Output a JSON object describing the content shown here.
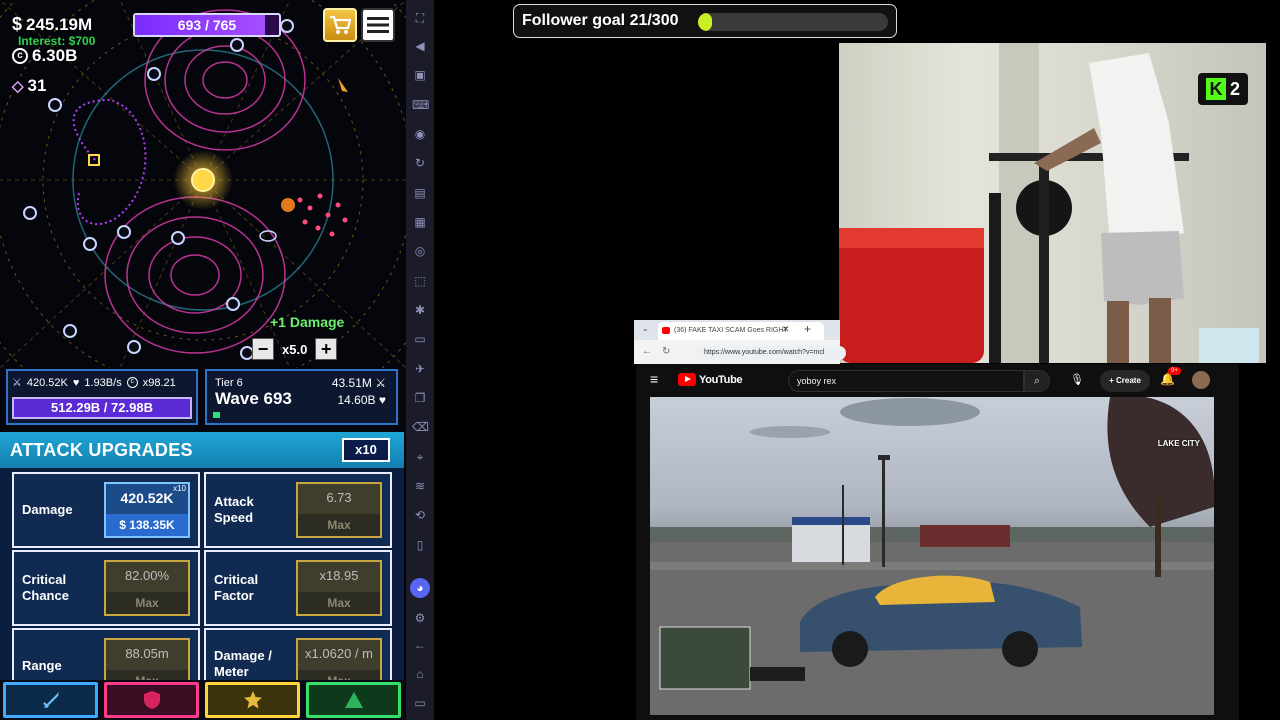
{
  "game": {
    "cash": "245.19M",
    "cash_symbol": "$",
    "interest": "Interest: $700",
    "coins": "6.30B",
    "gems": "31",
    "wave_progress_text": "693 / 765",
    "wave_progress_value": 0.906,
    "damage_float": "+1 Damage",
    "speed": "x5.0",
    "minus": "−",
    "plus": "+",
    "stats": {
      "damage": "420.52K",
      "regen": "1.93B/s",
      "coin_mult": "x98.21",
      "health_bar": "512.29B / 72.98B",
      "tier": "Tier 6",
      "wave": "Wave 693",
      "enemy_damage": "43.51M",
      "enemy_health": "14.60B",
      "wave_fraction": 0.04
    },
    "upgrades": {
      "title": "ATTACK UPGRADES",
      "multiplier": "x10",
      "items": [
        {
          "label": "Damage",
          "value": "420.52K",
          "cost": "$ 138.35K",
          "badge": "x10"
        },
        {
          "label": "Attack Speed",
          "value": "6.73",
          "cost": "Max"
        },
        {
          "label": "Critical Chance",
          "value": "82.00%",
          "cost": "Max"
        },
        {
          "label": "Critical Factor",
          "value": "x18.95",
          "cost": "Max"
        },
        {
          "label": "Range",
          "value": "88.05m",
          "cost": "Max"
        },
        {
          "label": "Damage / Meter",
          "value": "x1.0620 / m",
          "cost": "Max"
        }
      ]
    },
    "colors": {
      "tab_attack": "#3da9ff",
      "tab_defense": "#ff3b8a",
      "tab_utility": "#ffd43b",
      "tab_ultimate": "#35e06a"
    }
  },
  "follower_goal": {
    "text": "Follower goal 21/300",
    "value": 0.07
  },
  "webcam": {
    "badge_number": "2",
    "badge_letter": "K"
  },
  "browser": {
    "tab_title": "(36) FAKE TAXI SCAM Goes RIGHT",
    "url": "https://www.youtube.com/watch?v=mcl"
  },
  "youtube": {
    "logo_text": "YouTube",
    "search_query": "yoboy rex",
    "create_label": "Create",
    "notif_count": "9+",
    "overlay_location": "LAKE CITY"
  }
}
